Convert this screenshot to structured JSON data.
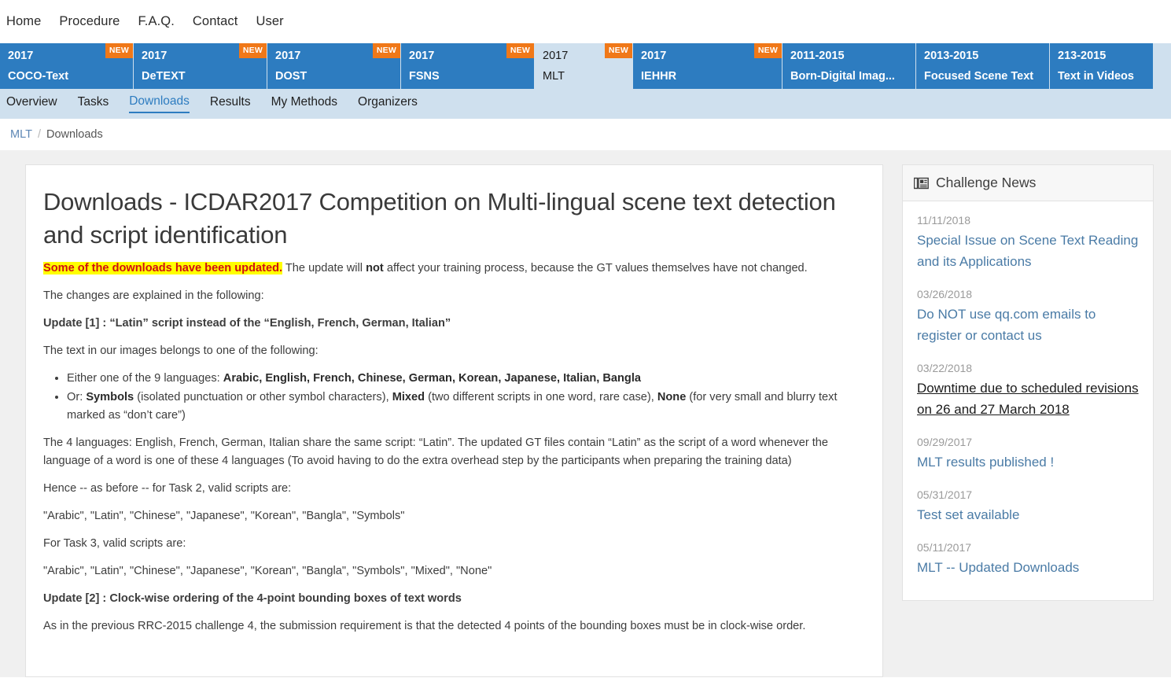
{
  "topnav": {
    "items": [
      {
        "label": "Home"
      },
      {
        "label": "Procedure"
      },
      {
        "label": "F.A.Q."
      },
      {
        "label": "Contact"
      },
      {
        "label": "User"
      }
    ]
  },
  "challenge_tabs": {
    "badge_label": "NEW",
    "accent_blue": "#2d7cc0",
    "active_bg": "#cfe0ee",
    "badge_color": "#f07818",
    "items": [
      {
        "year": "2017",
        "name": "COCO-Text",
        "is_new": true,
        "active": false
      },
      {
        "year": "2017",
        "name": "DeTEXT",
        "is_new": true,
        "active": false
      },
      {
        "year": "2017",
        "name": "DOST",
        "is_new": true,
        "active": false
      },
      {
        "year": "2017",
        "name": "FSNS",
        "is_new": true,
        "active": false
      },
      {
        "year": "2017",
        "name": "MLT",
        "is_new": true,
        "active": true
      },
      {
        "year": "2017",
        "name": "IEHHR",
        "is_new": true,
        "active": false
      },
      {
        "year": "2011-2015",
        "name": "Born-Digital Imag...",
        "is_new": false,
        "active": false
      },
      {
        "year": "2013-2015",
        "name": "Focused Scene Text",
        "is_new": false,
        "active": false
      },
      {
        "year": "213-2015",
        "name": "Text in Videos",
        "is_new": false,
        "active": false
      }
    ]
  },
  "subnav": {
    "items": [
      {
        "label": "Overview",
        "active": false
      },
      {
        "label": "Tasks",
        "active": false
      },
      {
        "label": "Downloads",
        "active": true
      },
      {
        "label": "Results",
        "active": false
      },
      {
        "label": "My Methods",
        "active": false
      },
      {
        "label": "Organizers",
        "active": false
      }
    ]
  },
  "breadcrumb": {
    "root": "MLT",
    "separator": "/",
    "current": "Downloads"
  },
  "main": {
    "title": "Downloads - ICDAR2017 Competition on Multi-lingual scene text detection and script identification",
    "highlight_notice": "Some of the downloads have been updated.",
    "notice_rest_1": " The update will ",
    "notice_bold": "not",
    "notice_rest_2": " affect your training process, because the GT values themselves have not changed.",
    "p_changes": "The changes are explained in the following:",
    "update1_heading": "Update [1] : “Latin” script instead of the “English, French, German, Italian”",
    "p_belongs": "The text in our images belongs to one of the following:",
    "bullet1_lead": "Either one of the 9 languages: ",
    "bullet1_bold": "Arabic, English, French, Chinese, German, Korean, Japanese, Italian, Bangla",
    "bullet2_lead": "Or: ",
    "bullet2_b1": "Symbols",
    "bullet2_t1": " (isolated punctuation or other symbol characters), ",
    "bullet2_b2": "Mixed",
    "bullet2_t2": " (two different scripts in one word, rare case), ",
    "bullet2_b3": "None",
    "bullet2_t3": " (for very small and blurry text marked as “don’t care”)",
    "p_four_languages": "The 4 languages: English, French, German, Italian share the same script: “Latin”. The updated GT files contain “Latin” as the script of a word whenever the language of a word is one of these 4 languages (To avoid having to do the extra overhead step by the participants when preparing the training data)",
    "p_task2_intro": "Hence -- as before -- for Task 2, valid scripts are:",
    "p_task2_list": "\"Arabic\", \"Latin\", \"Chinese\", \"Japanese\", \"Korean\", \"Bangla\", \"Symbols\"",
    "p_task3_intro": "For Task 3, valid scripts are:",
    "p_task3_list": "\"Arabic\", \"Latin\", \"Chinese\", \"Japanese\", \"Korean\", \"Bangla\", \"Symbols\", \"Mixed\", \"None\"",
    "update2_heading": "Update [2] : Clock-wise ordering of the 4-point bounding boxes of text words",
    "p_clockwise": "As in the previous RRC-2015 challenge 4, the submission requirement is that the detected 4 points of the bounding boxes must be in clock-wise order."
  },
  "news": {
    "panel_title": "Challenge News",
    "icon": "newspaper-icon",
    "items": [
      {
        "date": "11/11/2018",
        "title": "Special Issue on Scene Text Reading and its Applications",
        "visited": false
      },
      {
        "date": "03/26/2018",
        "title": "Do NOT use qq.com emails to register or contact us",
        "visited": false
      },
      {
        "date": "03/22/2018",
        "title": "Downtime due to scheduled revisions on 26 and 27 March 2018",
        "visited": true
      },
      {
        "date": "09/29/2017",
        "title": "MLT results published !",
        "visited": false
      },
      {
        "date": "05/31/2017",
        "title": "Test set available",
        "visited": false
      },
      {
        "date": "05/11/2017",
        "title": "MLT -- Updated Downloads",
        "visited": false
      }
    ]
  }
}
